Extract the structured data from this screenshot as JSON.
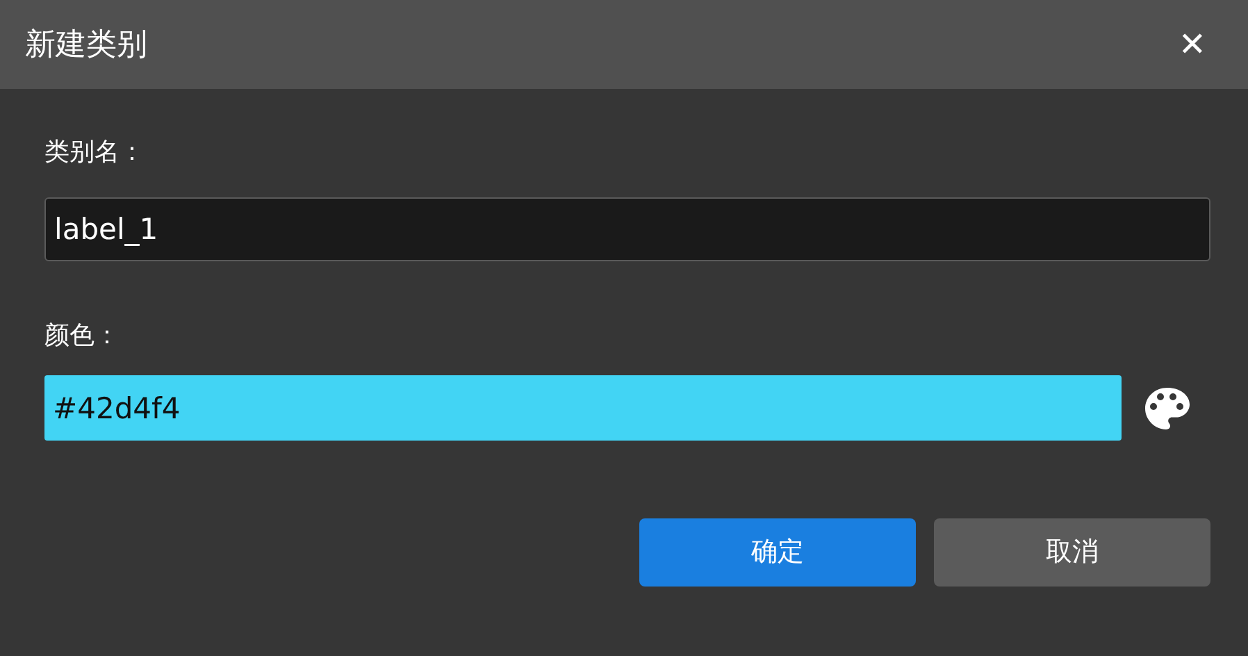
{
  "window": {
    "title": "新建类别",
    "close": "✕"
  },
  "name_field": {
    "label": "类别名：",
    "value": "label_1"
  },
  "color_field": {
    "label": "颜色：",
    "value": "#42d4f4",
    "color": "#42d4f4"
  },
  "buttons": [
    {
      "label": "确定",
      "kind": "primary"
    },
    {
      "label": "取消",
      "kind": "secondary"
    }
  ]
}
